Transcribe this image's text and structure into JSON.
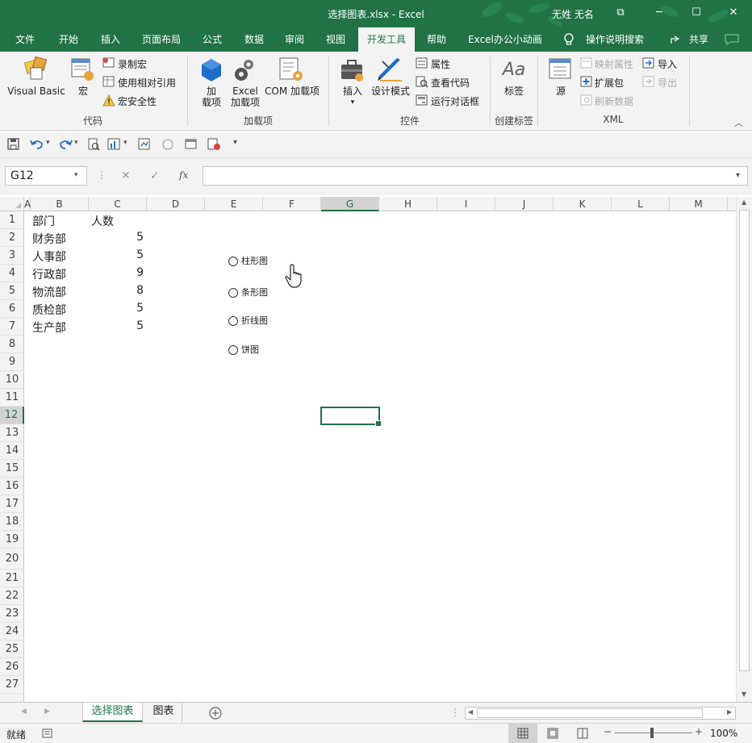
{
  "window": {
    "title": "选择图表.xlsx  -  Excel",
    "user": "无姓 无名",
    "controls": {
      "ribbon_display": "⧉",
      "minimize": "─",
      "maximize": "☐",
      "close": "✕"
    }
  },
  "tabs": [
    {
      "label": "文件",
      "active": false
    },
    {
      "label": "开始",
      "active": false
    },
    {
      "label": "插入",
      "active": false
    },
    {
      "label": "页面布局",
      "active": false
    },
    {
      "label": "公式",
      "active": false
    },
    {
      "label": "数据",
      "active": false
    },
    {
      "label": "审阅",
      "active": false
    },
    {
      "label": "视图",
      "active": false
    },
    {
      "label": "开发工具",
      "active": true
    },
    {
      "label": "帮助",
      "active": false
    },
    {
      "label": "Excel办公小动画",
      "active": false
    }
  ],
  "search": {
    "label": "操作说明搜索"
  },
  "share": {
    "label": "共享"
  },
  "ribbon": {
    "code": {
      "group_label": "代码",
      "visual_basic": "Visual Basic",
      "macros": "宏",
      "record_macro": "录制宏",
      "relative_ref": "使用相对引用",
      "macro_security": "宏安全性"
    },
    "addins": {
      "group_label": "加载项",
      "addins_line1": "加",
      "addins_line2": "载项",
      "excel_addins_line1": "Excel",
      "excel_addins_line2": "加载项",
      "com_addins": "COM 加载项"
    },
    "controls": {
      "group_label": "控件",
      "insert": "插入",
      "design_mode": "设计模式",
      "properties": "属性",
      "view_code": "查看代码",
      "run_dialog": "运行对话框"
    },
    "labels": {
      "group_label": "创建标签",
      "label": "标签",
      "icon_text": "Aa"
    },
    "xml": {
      "group_label": "XML",
      "source": "源",
      "map_properties": "映射属性",
      "expansion_packs": "扩展包",
      "refresh_data": "刷新数据",
      "import": "导入",
      "export": "导出"
    }
  },
  "formula_bar": {
    "name_box": "G12",
    "cancel": "✕",
    "enter": "✓",
    "fx": "fx",
    "value": ""
  },
  "columns": [
    "A",
    "B",
    "C",
    "D",
    "E",
    "F",
    "G",
    "H",
    "I",
    "J",
    "K",
    "L",
    "M"
  ],
  "selected_column": "G",
  "rows": [
    "1",
    "2",
    "3",
    "4",
    "5",
    "6",
    "7",
    "8",
    "9",
    "10",
    "11",
    "12",
    "13",
    "14",
    "15",
    "16",
    "17",
    "18",
    "19",
    "20",
    "21",
    "22",
    "23",
    "24",
    "25",
    "26",
    "27"
  ],
  "selected_row": "12",
  "table": {
    "header": {
      "dept": "部门",
      "count": "人数"
    },
    "rows": [
      {
        "dept": "财务部",
        "count": "5"
      },
      {
        "dept": "人事部",
        "count": "5"
      },
      {
        "dept": "行政部",
        "count": "9"
      },
      {
        "dept": "物流部",
        "count": "8"
      },
      {
        "dept": "质检部",
        "count": "5"
      },
      {
        "dept": "生产部",
        "count": "5"
      }
    ]
  },
  "option_buttons": [
    "柱形图",
    "条形图",
    "折线图",
    "饼图"
  ],
  "sheets": [
    {
      "label": "选择图表",
      "active": true
    },
    {
      "label": "图表",
      "active": false
    }
  ],
  "status": {
    "ready": "就绪",
    "zoom": "100%"
  }
}
